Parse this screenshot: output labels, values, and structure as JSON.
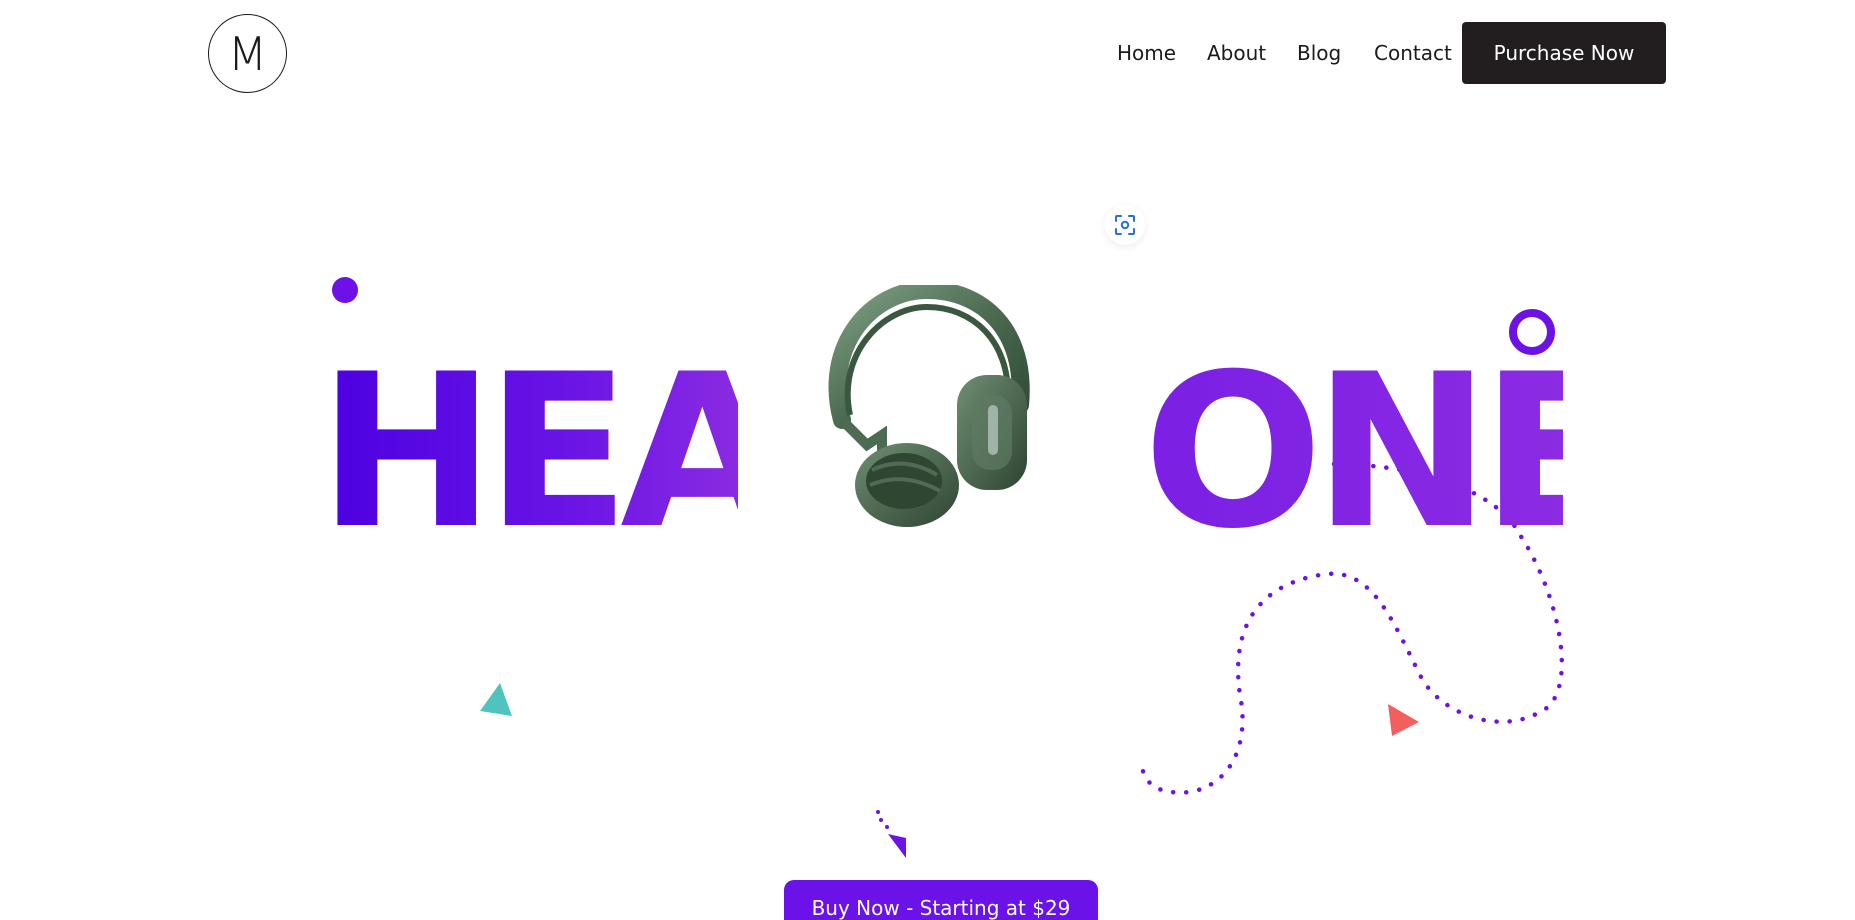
{
  "header": {
    "logo_letter": "M",
    "nav_items": [
      "Home",
      "About",
      "Blog",
      "Contact"
    ],
    "purchase_label": "Purchase Now"
  },
  "hero": {
    "word_left": "HEAD",
    "word_right": "ONE",
    "cta_label": "Buy Now - Starting at $29"
  },
  "colors": {
    "brand_purple": "#6a12e8",
    "dark": "#221e1f",
    "teal": "#4fc4bf",
    "coral": "#f2605d"
  },
  "icons": {
    "scan": "scan-focus-icon",
    "product": "headphones-image"
  }
}
